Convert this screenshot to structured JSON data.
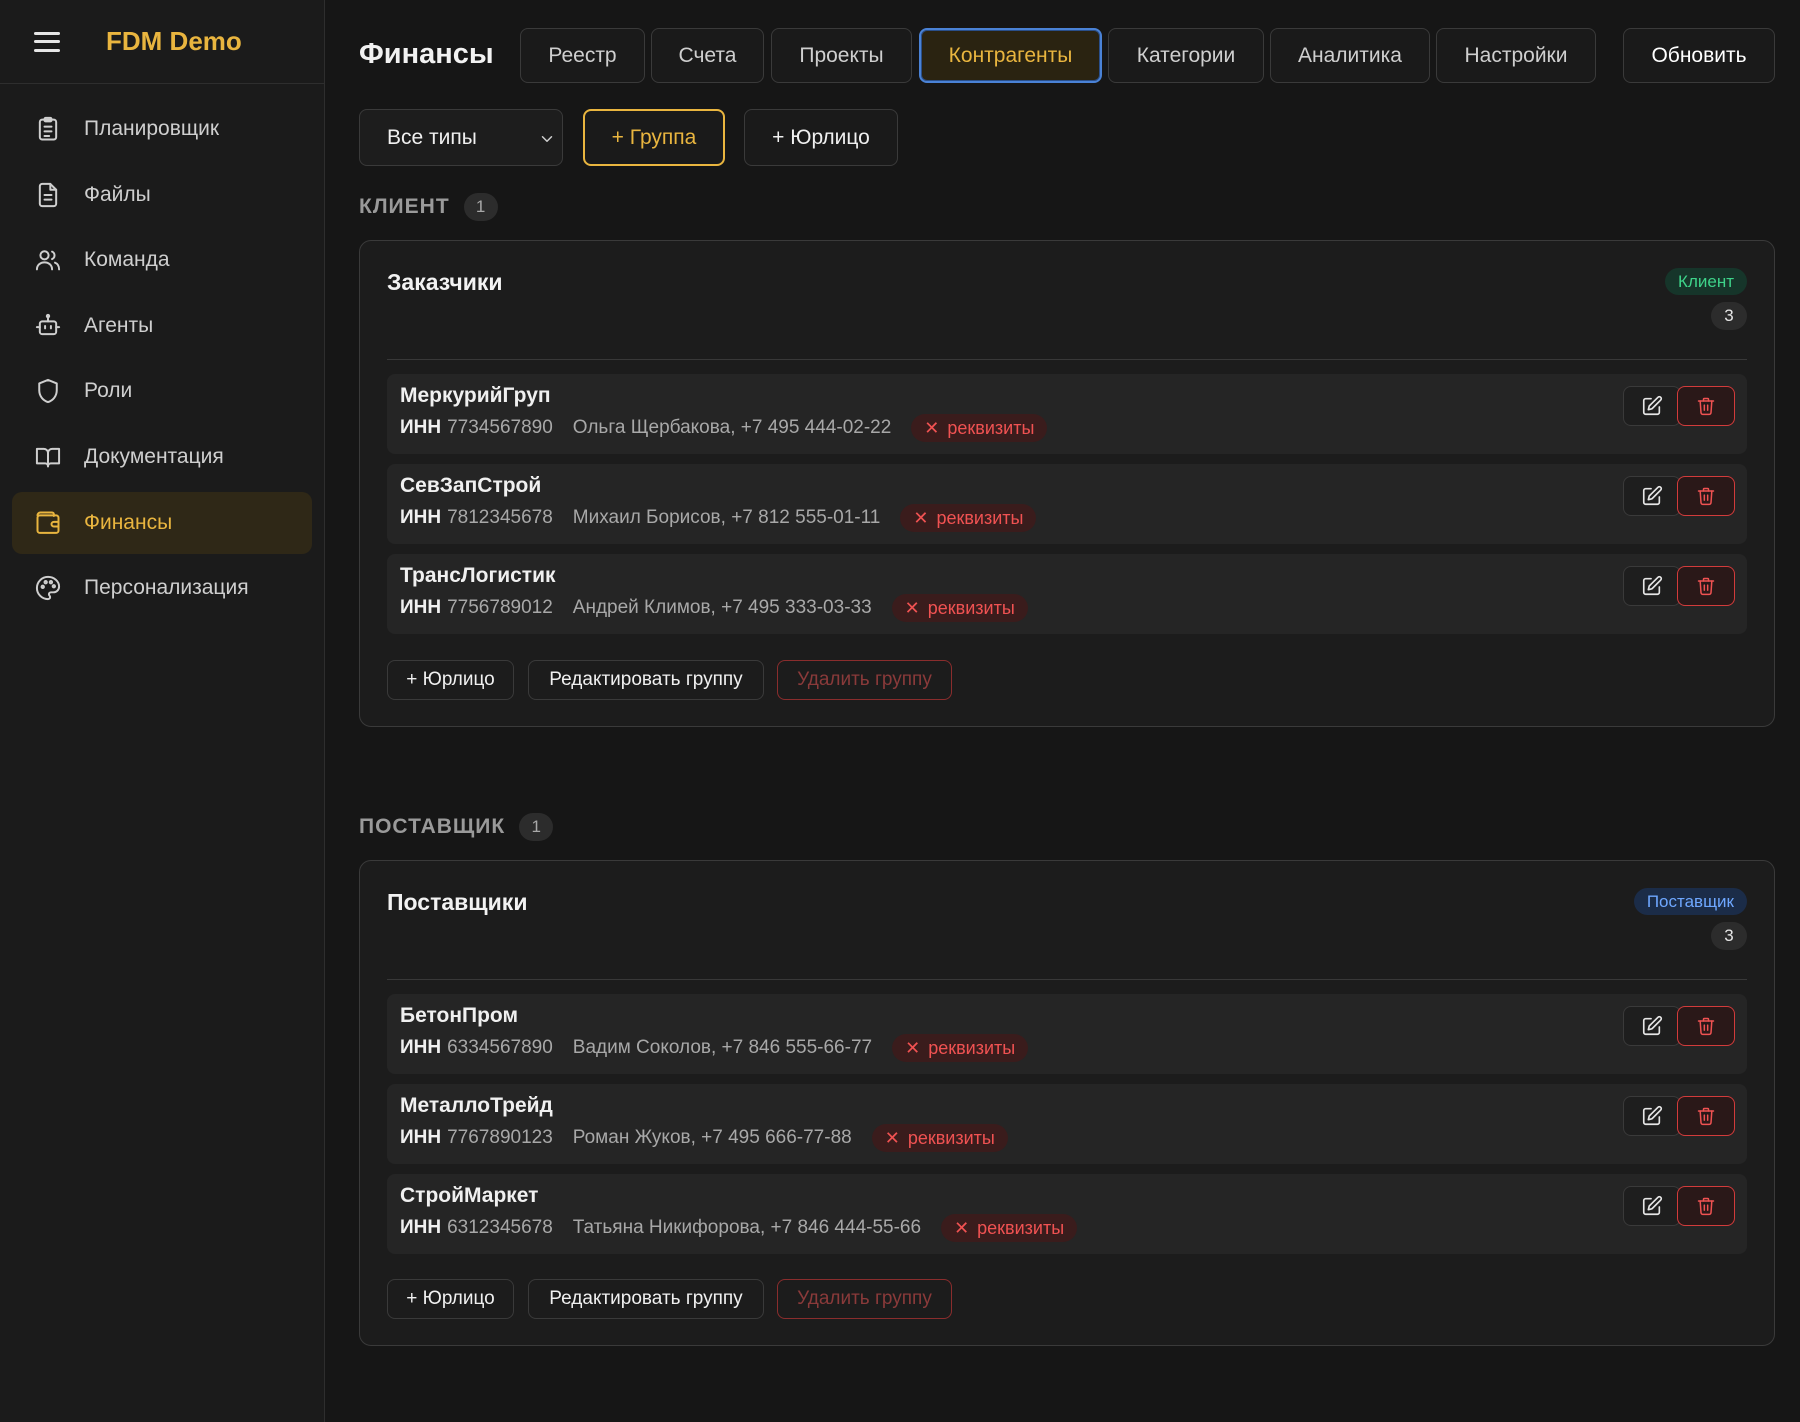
{
  "app": {
    "brand": "FDM Demo"
  },
  "sidebar": {
    "items": [
      {
        "label": "Планировщик",
        "icon": "clipboard-icon",
        "active": false
      },
      {
        "label": "Файлы",
        "icon": "file-icon",
        "active": false
      },
      {
        "label": "Команда",
        "icon": "users-icon",
        "active": false
      },
      {
        "label": "Агенты",
        "icon": "robot-icon",
        "active": false
      },
      {
        "label": "Роли",
        "icon": "shield-icon",
        "active": false
      },
      {
        "label": "Документация",
        "icon": "book-icon",
        "active": false
      },
      {
        "label": "Финансы",
        "icon": "wallet-icon",
        "active": true
      },
      {
        "label": "Персонализация",
        "icon": "palette-icon",
        "active": false
      }
    ]
  },
  "header": {
    "title": "Финансы",
    "tabs": [
      {
        "label": "Реестр",
        "active": false
      },
      {
        "label": "Счета",
        "active": false
      },
      {
        "label": "Проекты",
        "active": false
      },
      {
        "label": "Контрагенты",
        "active": true
      },
      {
        "label": "Категории",
        "active": false
      },
      {
        "label": "Аналитика",
        "active": false
      },
      {
        "label": "Настройки",
        "active": false
      }
    ],
    "refresh_label": "Обновить"
  },
  "toolbar": {
    "type_filter": "Все типы",
    "add_group_label": "+ Группа",
    "add_legal_label": "+ Юрлицо"
  },
  "sections": [
    {
      "label": "КЛИЕНТ",
      "count": "1",
      "group": {
        "title": "Заказчики",
        "type_badge": "Клиент",
        "count": "3",
        "entities": [
          {
            "name": "МеркурийГруп",
            "inn_label": "ИНН",
            "inn": "7734567890",
            "contact": "Ольга Щербакова, +7 495 444-02-22",
            "badge": "реквизиты"
          },
          {
            "name": "СевЗапСтрой",
            "inn_label": "ИНН",
            "inn": "7812345678",
            "contact": "Михаил Борисов, +7 812 555-01-11",
            "badge": "реквизиты"
          },
          {
            "name": "ТрансЛогистик",
            "inn_label": "ИНН",
            "inn": "7756789012",
            "contact": "Андрей Климов, +7 495 333-03-33",
            "badge": "реквизиты"
          }
        ],
        "add_label": "+ Юрлицо",
        "edit_label": "Редактировать группу",
        "delete_label": "Удалить группу"
      }
    },
    {
      "label": "ПОСТАВЩИК",
      "count": "1",
      "group": {
        "title": "Поставщики",
        "type_badge": "Поставщик",
        "count": "3",
        "entities": [
          {
            "name": "БетонПром",
            "inn_label": "ИНН",
            "inn": "6334567890",
            "contact": "Вадим Соколов, +7 846 555-66-77",
            "badge": "реквизиты"
          },
          {
            "name": "МеталлоТрейд",
            "inn_label": "ИНН",
            "inn": "7767890123",
            "contact": "Роман Жуков, +7 495 666-77-88",
            "badge": "реквизиты"
          },
          {
            "name": "СтройМаркет",
            "inn_label": "ИНН",
            "inn": "6312345678",
            "contact": "Татьяна Никифорова, +7 846 444-55-66",
            "badge": "реквизиты"
          }
        ],
        "add_label": "+ Юрлицо",
        "edit_label": "Редактировать группу",
        "delete_label": "Удалить группу"
      }
    }
  ],
  "colors": {
    "accent": "#e9b53f",
    "danger": "#f05252",
    "client_badge": "#3ed38a",
    "supplier_badge": "#6ea7ff",
    "active_tab_border": "#4a82d6"
  }
}
